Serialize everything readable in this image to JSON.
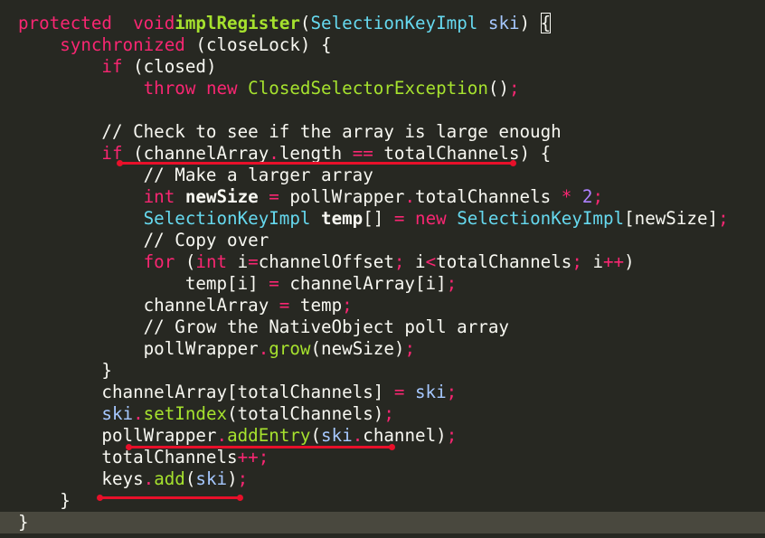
{
  "editor": {
    "language": "java",
    "theme_colors": {
      "background": "#272822",
      "current_line": "#49483e",
      "text": "#f8f8f2",
      "keyword": "#f92672",
      "function": "#a6e22e",
      "type": "#66d9ef",
      "variable": "#a6c8ff",
      "number": "#ae81ff",
      "annotation": "#e8102a"
    },
    "lines": [
      [
        [
          "kw",
          "protected"
        ],
        [
          "",
          "  "
        ],
        [
          "kw",
          "void"
        ],
        [
          "",
          ""
        ],
        [
          "fn bold",
          "implRegister"
        ],
        [
          "",
          "("
        ],
        [
          "type",
          "SelectionKeyImpl"
        ],
        [
          "",
          " "
        ],
        [
          "var",
          "ski"
        ],
        [
          "",
          ") "
        ],
        [
          "brace",
          "{"
        ]
      ],
      [
        [
          "",
          "    "
        ],
        [
          "kw",
          "synchronized"
        ],
        [
          "",
          " (closeLock) {"
        ]
      ],
      [
        [
          "",
          "        "
        ],
        [
          "kw",
          "if"
        ],
        [
          "",
          " (closed)"
        ]
      ],
      [
        [
          "",
          "            "
        ],
        [
          "kw",
          "throw"
        ],
        [
          "",
          " "
        ],
        [
          "kw",
          "new"
        ],
        [
          "",
          " "
        ],
        [
          "fn",
          "ClosedSelectorException"
        ],
        [
          "",
          "()"
        ],
        [
          "kw",
          ";"
        ]
      ],
      [
        [
          "",
          ""
        ]
      ],
      [
        [
          "",
          "        // Check to see if the array is large enough"
        ]
      ],
      [
        [
          "",
          "        "
        ],
        [
          "kw",
          "if"
        ],
        [
          "",
          " (channelArray"
        ],
        [
          "kw",
          "."
        ],
        [
          "",
          "length "
        ],
        [
          "kw",
          "=="
        ],
        [
          "",
          " totalChannels) {"
        ]
      ],
      [
        [
          "",
          "            // Make a larger array"
        ]
      ],
      [
        [
          "",
          "            "
        ],
        [
          "kw",
          "int"
        ],
        [
          "",
          " "
        ],
        [
          "bold",
          "newSize"
        ],
        [
          "",
          " "
        ],
        [
          "kw",
          "="
        ],
        [
          "",
          " pollWrapper"
        ],
        [
          "kw",
          "."
        ],
        [
          "",
          "totalChannels "
        ],
        [
          "kw",
          "*"
        ],
        [
          "",
          " "
        ],
        [
          "num",
          "2"
        ],
        [
          "kw",
          ";"
        ]
      ],
      [
        [
          "",
          "            "
        ],
        [
          "type",
          "SelectionKeyImpl"
        ],
        [
          "",
          " "
        ],
        [
          "bold",
          "temp"
        ],
        [
          "",
          "[] "
        ],
        [
          "kw",
          "="
        ],
        [
          "",
          " "
        ],
        [
          "kw",
          "new"
        ],
        [
          "",
          " "
        ],
        [
          "type",
          "SelectionKeyImpl"
        ],
        [
          "",
          "[newSize]"
        ],
        [
          "kw",
          ";"
        ]
      ],
      [
        [
          "",
          "            // Copy over"
        ]
      ],
      [
        [
          "",
          "            "
        ],
        [
          "kw",
          "for"
        ],
        [
          "",
          " ("
        ],
        [
          "kw",
          "int"
        ],
        [
          "",
          " i"
        ],
        [
          "kw",
          "="
        ],
        [
          "",
          "channelOffset"
        ],
        [
          "kw",
          ";"
        ],
        [
          "",
          " i"
        ],
        [
          "kw",
          "<"
        ],
        [
          "",
          "totalChannels"
        ],
        [
          "kw",
          ";"
        ],
        [
          "",
          " i"
        ],
        [
          "kw",
          "++"
        ],
        [
          "",
          ")"
        ]
      ],
      [
        [
          "",
          "                temp[i] "
        ],
        [
          "kw",
          "="
        ],
        [
          "",
          " channelArray[i]"
        ],
        [
          "kw",
          ";"
        ]
      ],
      [
        [
          "",
          "            channelArray "
        ],
        [
          "kw",
          "="
        ],
        [
          "",
          " temp"
        ],
        [
          "kw",
          ";"
        ]
      ],
      [
        [
          "",
          "            // Grow the NativeObject poll array"
        ]
      ],
      [
        [
          "",
          "            pollWrapper"
        ],
        [
          "kw",
          "."
        ],
        [
          "fn",
          "grow"
        ],
        [
          "",
          "(newSize)"
        ],
        [
          "kw",
          ";"
        ]
      ],
      [
        [
          "",
          "        }"
        ]
      ],
      [
        [
          "",
          "        channelArray[totalChannels] "
        ],
        [
          "kw",
          "="
        ],
        [
          "",
          " "
        ],
        [
          "var",
          "ski"
        ],
        [
          "kw",
          ";"
        ]
      ],
      [
        [
          "",
          "        "
        ],
        [
          "var",
          "ski"
        ],
        [
          "kw",
          "."
        ],
        [
          "fn",
          "setIndex"
        ],
        [
          "",
          "(totalChannels)"
        ],
        [
          "kw",
          ";"
        ]
      ],
      [
        [
          "",
          "        pollWrapper"
        ],
        [
          "kw",
          "."
        ],
        [
          "fn",
          "addEntry"
        ],
        [
          "",
          "("
        ],
        [
          "var",
          "ski"
        ],
        [
          "kw",
          "."
        ],
        [
          "",
          "channel)"
        ],
        [
          "kw",
          ";"
        ]
      ],
      [
        [
          "",
          "        totalChannels"
        ],
        [
          "kw",
          "++;"
        ]
      ],
      [
        [
          "",
          "        keys"
        ],
        [
          "kw",
          "."
        ],
        [
          "fn",
          "add"
        ],
        [
          "",
          "("
        ],
        [
          "var",
          "ski"
        ],
        [
          "",
          ")"
        ],
        [
          "kw",
          ";"
        ]
      ],
      [
        [
          "",
          "    }"
        ]
      ],
      [
        [
          "",
          "}"
        ]
      ]
    ],
    "current_line_index": 23,
    "annotations": [
      {
        "name": "underline-if-condition",
        "line": 6
      },
      {
        "name": "underline-add-entry",
        "line": 19
      },
      {
        "name": "underline-closing-brace",
        "line": 22
      }
    ]
  }
}
